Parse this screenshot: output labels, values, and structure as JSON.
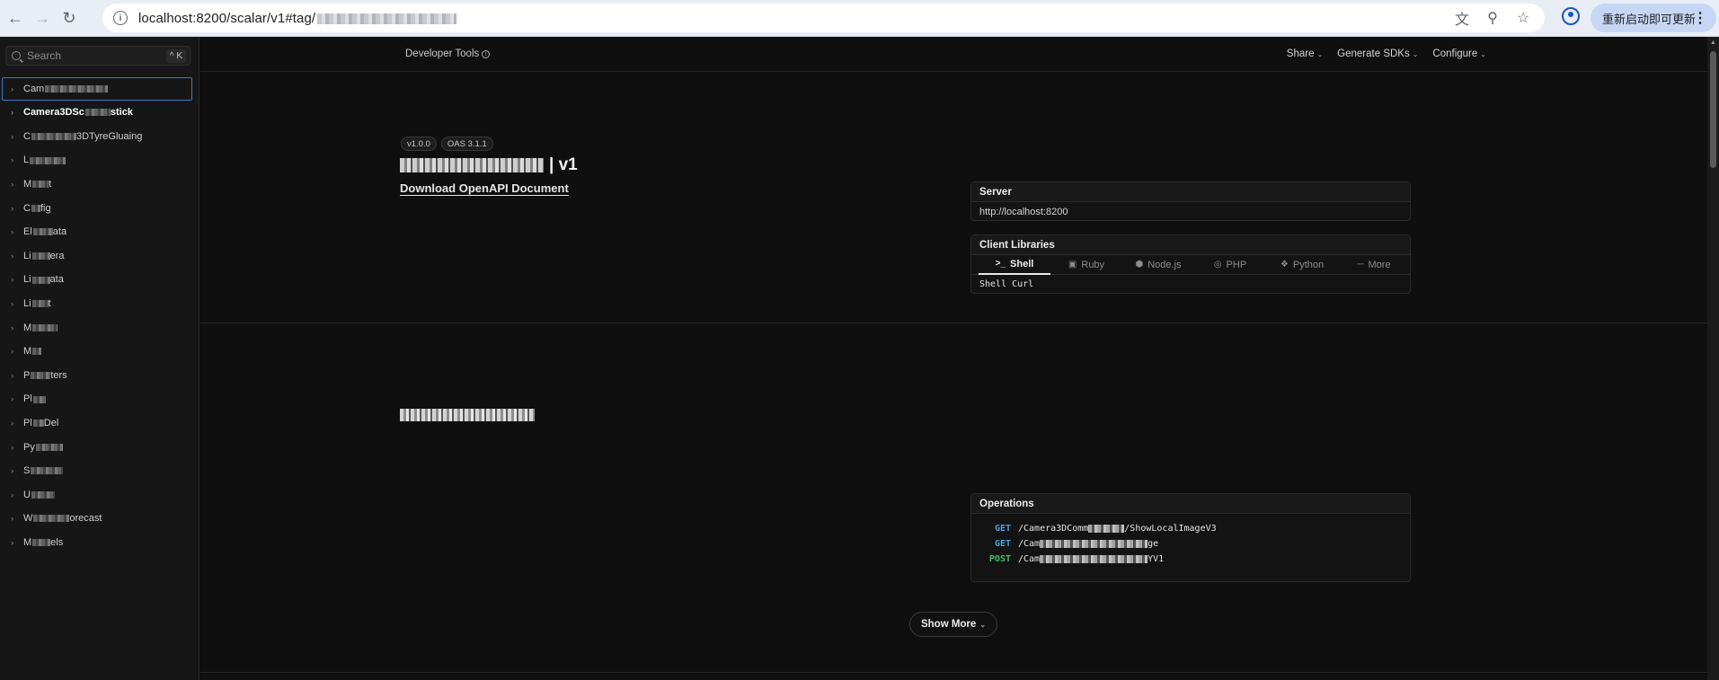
{
  "browser": {
    "url_prefix": "localhost:8200/scalar/v1#tag/",
    "url_blurred": "c………………n",
    "update_button": "重新启动即可更新"
  },
  "sidebar": {
    "search_placeholder": "Search",
    "search_shortcut": "^ K",
    "items": [
      {
        "label": "Cam",
        "blur": 70,
        "active": true,
        "bold": false
      },
      {
        "label": "Camera3DSc",
        "blur": 28,
        "tail": "stick",
        "active": false,
        "bold": true
      },
      {
        "label": "C",
        "blur": 50,
        "tail": "3DTyreGluaing",
        "active": false,
        "bold": false
      },
      {
        "label": "L",
        "blur": 40,
        "tail": "",
        "active": false,
        "bold": false
      },
      {
        "label": "M",
        "blur": 18,
        "tail": "t",
        "active": false,
        "bold": false
      },
      {
        "label": "C",
        "blur": 10,
        "tail": "fig",
        "active": false,
        "bold": false
      },
      {
        "label": "El",
        "blur": 22,
        "tail": "ata",
        "active": false,
        "bold": false
      },
      {
        "label": "Li",
        "blur": 20,
        "tail": "era",
        "active": false,
        "bold": false
      },
      {
        "label": "Li",
        "blur": 20,
        "tail": "ata",
        "active": false,
        "bold": false
      },
      {
        "label": "Li",
        "blur": 18,
        "tail": "t",
        "active": false,
        "bold": false
      },
      {
        "label": "M",
        "blur": 28,
        "tail": "",
        "active": false,
        "bold": false
      },
      {
        "label": "M",
        "blur": 10,
        "tail": "",
        "active": false,
        "bold": false
      },
      {
        "label": "P",
        "blur": 22,
        "tail": "ters",
        "active": false,
        "bold": false
      },
      {
        "label": "Pl",
        "blur": 14,
        "tail": "",
        "active": false,
        "bold": false
      },
      {
        "label": "Pl",
        "blur": 12,
        "tail": "Del",
        "active": false,
        "bold": false
      },
      {
        "label": "Py",
        "blur": 30,
        "tail": "",
        "active": false,
        "bold": false
      },
      {
        "label": "S",
        "blur": 36,
        "tail": "",
        "active": false,
        "bold": false
      },
      {
        "label": "U",
        "blur": 26,
        "tail": "",
        "active": false,
        "bold": false
      },
      {
        "label": "W",
        "blur": 40,
        "tail": "orecast",
        "active": false,
        "bold": false
      },
      {
        "label": "M",
        "blur": 20,
        "tail": "els",
        "active": false,
        "bold": false
      }
    ]
  },
  "topbar": {
    "developer_tools": "Developer Tools",
    "share": "Share",
    "generate_sdks": "Generate SDKs",
    "configure": "Configure"
  },
  "intro": {
    "version_badge": "v1.0.0",
    "oas_badge": "OAS 3.1.1",
    "title_suffix": "| v1",
    "download": "Download OpenAPI Document"
  },
  "server": {
    "heading": "Server",
    "url": "http://localhost:8200"
  },
  "client_libraries": {
    "heading": "Client Libraries",
    "tabs": [
      {
        "icon": ">_",
        "label": "Shell",
        "active": true
      },
      {
        "icon": "▣",
        "label": "Ruby",
        "active": false
      },
      {
        "icon": "⬢",
        "label": "Node.js",
        "active": false
      },
      {
        "icon": "◎",
        "label": "PHP",
        "active": false
      },
      {
        "icon": "❖",
        "label": "Python",
        "active": false
      },
      {
        "icon": "─",
        "label": "More",
        "active": false
      }
    ],
    "code": "Shell Curl"
  },
  "operations": {
    "heading": "Operations",
    "rows": [
      {
        "method": "GET",
        "path_start": "/Camera3DComm",
        "path_end": "/ShowLocalImageV3"
      },
      {
        "method": "GET",
        "path_start": "/Cam",
        "path_end": "ge"
      },
      {
        "method": "POST",
        "path_start": "/Cam",
        "path_end": "YV1"
      }
    ]
  },
  "show_more": "Show More",
  "colors": {
    "get": "#4aa3df",
    "post": "#3cbf6a",
    "active_outline": "#3b79c9"
  }
}
